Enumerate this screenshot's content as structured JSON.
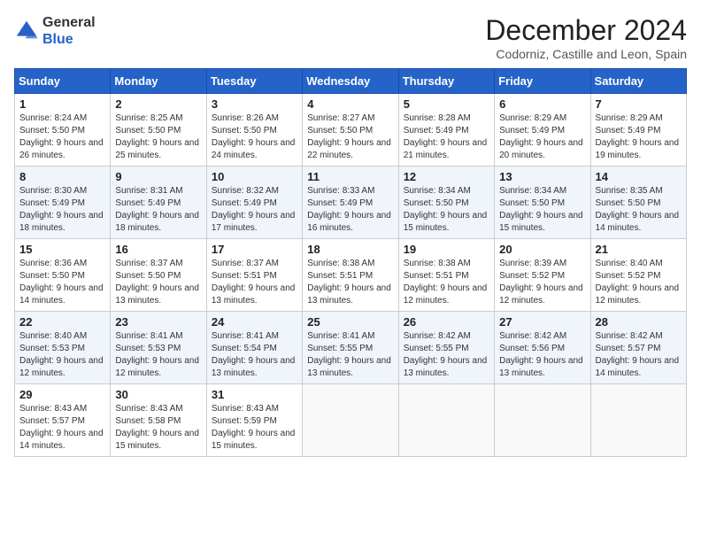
{
  "header": {
    "logo_line1": "General",
    "logo_line2": "Blue",
    "month_year": "December 2024",
    "location": "Codorniz, Castille and Leon, Spain"
  },
  "weekdays": [
    "Sunday",
    "Monday",
    "Tuesday",
    "Wednesday",
    "Thursday",
    "Friday",
    "Saturday"
  ],
  "weeks": [
    [
      {
        "day": "1",
        "sunrise": "8:24 AM",
        "sunset": "5:50 PM",
        "daylight": "9 hours and 26 minutes."
      },
      {
        "day": "2",
        "sunrise": "8:25 AM",
        "sunset": "5:50 PM",
        "daylight": "9 hours and 25 minutes."
      },
      {
        "day": "3",
        "sunrise": "8:26 AM",
        "sunset": "5:50 PM",
        "daylight": "9 hours and 24 minutes."
      },
      {
        "day": "4",
        "sunrise": "8:27 AM",
        "sunset": "5:50 PM",
        "daylight": "9 hours and 22 minutes."
      },
      {
        "day": "5",
        "sunrise": "8:28 AM",
        "sunset": "5:49 PM",
        "daylight": "9 hours and 21 minutes."
      },
      {
        "day": "6",
        "sunrise": "8:29 AM",
        "sunset": "5:49 PM",
        "daylight": "9 hours and 20 minutes."
      },
      {
        "day": "7",
        "sunrise": "8:29 AM",
        "sunset": "5:49 PM",
        "daylight": "9 hours and 19 minutes."
      }
    ],
    [
      {
        "day": "8",
        "sunrise": "8:30 AM",
        "sunset": "5:49 PM",
        "daylight": "9 hours and 18 minutes."
      },
      {
        "day": "9",
        "sunrise": "8:31 AM",
        "sunset": "5:49 PM",
        "daylight": "9 hours and 18 minutes."
      },
      {
        "day": "10",
        "sunrise": "8:32 AM",
        "sunset": "5:49 PM",
        "daylight": "9 hours and 17 minutes."
      },
      {
        "day": "11",
        "sunrise": "8:33 AM",
        "sunset": "5:49 PM",
        "daylight": "9 hours and 16 minutes."
      },
      {
        "day": "12",
        "sunrise": "8:34 AM",
        "sunset": "5:50 PM",
        "daylight": "9 hours and 15 minutes."
      },
      {
        "day": "13",
        "sunrise": "8:34 AM",
        "sunset": "5:50 PM",
        "daylight": "9 hours and 15 minutes."
      },
      {
        "day": "14",
        "sunrise": "8:35 AM",
        "sunset": "5:50 PM",
        "daylight": "9 hours and 14 minutes."
      }
    ],
    [
      {
        "day": "15",
        "sunrise": "8:36 AM",
        "sunset": "5:50 PM",
        "daylight": "9 hours and 14 minutes."
      },
      {
        "day": "16",
        "sunrise": "8:37 AM",
        "sunset": "5:50 PM",
        "daylight": "9 hours and 13 minutes."
      },
      {
        "day": "17",
        "sunrise": "8:37 AM",
        "sunset": "5:51 PM",
        "daylight": "9 hours and 13 minutes."
      },
      {
        "day": "18",
        "sunrise": "8:38 AM",
        "sunset": "5:51 PM",
        "daylight": "9 hours and 13 minutes."
      },
      {
        "day": "19",
        "sunrise": "8:38 AM",
        "sunset": "5:51 PM",
        "daylight": "9 hours and 12 minutes."
      },
      {
        "day": "20",
        "sunrise": "8:39 AM",
        "sunset": "5:52 PM",
        "daylight": "9 hours and 12 minutes."
      },
      {
        "day": "21",
        "sunrise": "8:40 AM",
        "sunset": "5:52 PM",
        "daylight": "9 hours and 12 minutes."
      }
    ],
    [
      {
        "day": "22",
        "sunrise": "8:40 AM",
        "sunset": "5:53 PM",
        "daylight": "9 hours and 12 minutes."
      },
      {
        "day": "23",
        "sunrise": "8:41 AM",
        "sunset": "5:53 PM",
        "daylight": "9 hours and 12 minutes."
      },
      {
        "day": "24",
        "sunrise": "8:41 AM",
        "sunset": "5:54 PM",
        "daylight": "9 hours and 13 minutes."
      },
      {
        "day": "25",
        "sunrise": "8:41 AM",
        "sunset": "5:55 PM",
        "daylight": "9 hours and 13 minutes."
      },
      {
        "day": "26",
        "sunrise": "8:42 AM",
        "sunset": "5:55 PM",
        "daylight": "9 hours and 13 minutes."
      },
      {
        "day": "27",
        "sunrise": "8:42 AM",
        "sunset": "5:56 PM",
        "daylight": "9 hours and 13 minutes."
      },
      {
        "day": "28",
        "sunrise": "8:42 AM",
        "sunset": "5:57 PM",
        "daylight": "9 hours and 14 minutes."
      }
    ],
    [
      {
        "day": "29",
        "sunrise": "8:43 AM",
        "sunset": "5:57 PM",
        "daylight": "9 hours and 14 minutes."
      },
      {
        "day": "30",
        "sunrise": "8:43 AM",
        "sunset": "5:58 PM",
        "daylight": "9 hours and 15 minutes."
      },
      {
        "day": "31",
        "sunrise": "8:43 AM",
        "sunset": "5:59 PM",
        "daylight": "9 hours and 15 minutes."
      },
      null,
      null,
      null,
      null
    ]
  ],
  "labels": {
    "sunrise": "Sunrise:",
    "sunset": "Sunset:",
    "daylight": "Daylight:"
  }
}
